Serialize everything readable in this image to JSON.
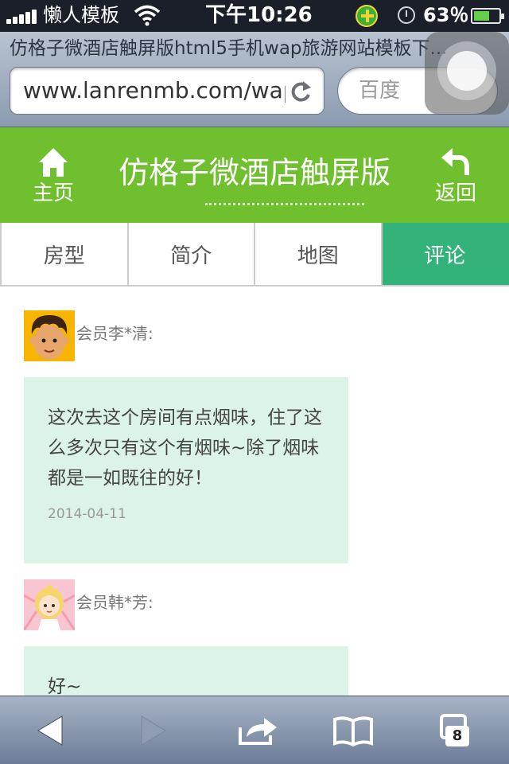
{
  "status_bar": {
    "carrier": "懒人模板",
    "time": "下午10:26",
    "battery_percent": "63％",
    "battery_level": 0.63
  },
  "browser": {
    "page_title": "仿格子微酒店触屏版html5手机wap旅游网站模板下...",
    "url": "www.lanrenmb.com/wap",
    "search_placeholder": "百度",
    "open_tabs_count": "8"
  },
  "header": {
    "home_label": "主页",
    "title": "仿格子微酒店触屏版",
    "back_label": "返回",
    "color": "#6fbf2f"
  },
  "tabs": [
    {
      "label": "房型",
      "active": false
    },
    {
      "label": "简介",
      "active": false
    },
    {
      "label": "地图",
      "active": false
    },
    {
      "label": "评论",
      "active": true
    }
  ],
  "accent_color": "#33b27a",
  "comments": [
    {
      "author": "会员李*清:",
      "avatar": "boy-avatar",
      "text": "这次去这个房间有点烟味，住了这么多次只有这个有烟味~除了烟味都是一如既往的好！",
      "date": "2014-04-11"
    },
    {
      "author": "会员韩*芳:",
      "avatar": "girl-avatar",
      "text": "好~",
      "date": ""
    }
  ]
}
